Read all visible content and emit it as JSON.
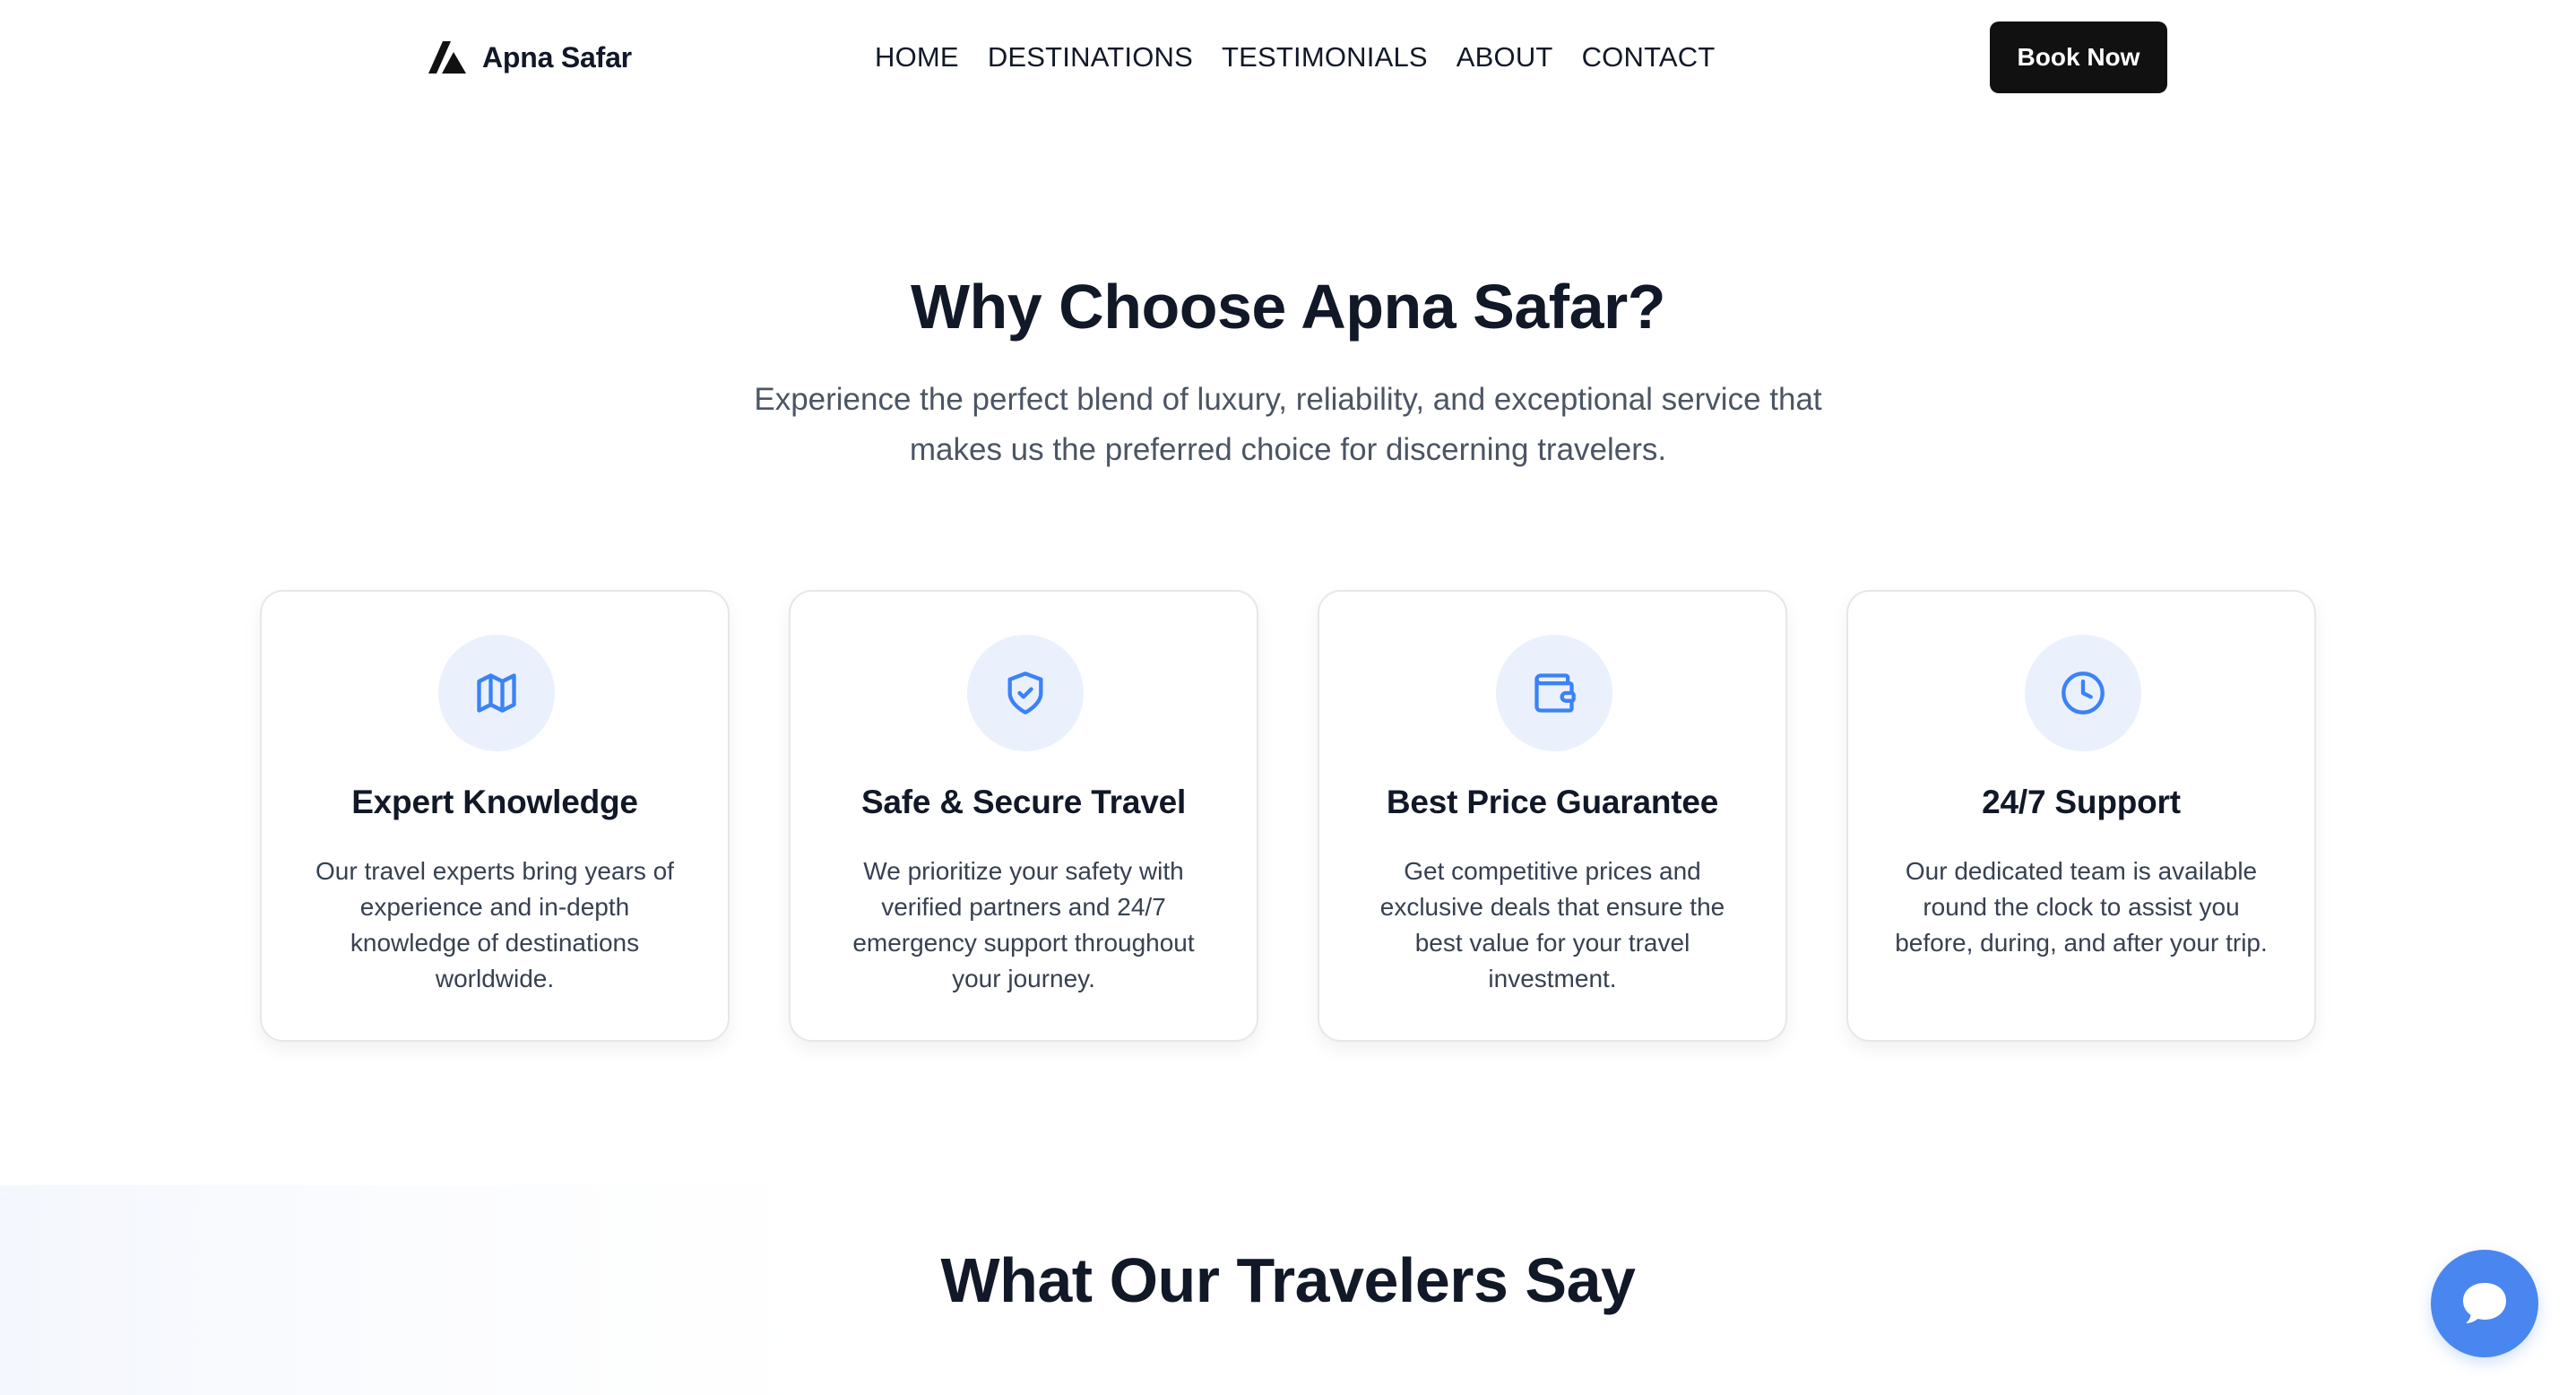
{
  "header": {
    "brand_name": "Apna Safar",
    "logo_icon": "mountain-logo-icon",
    "nav": [
      {
        "label": "HOME"
      },
      {
        "label": "DESTINATIONS"
      },
      {
        "label": "TESTIMONIALS"
      },
      {
        "label": "ABOUT"
      },
      {
        "label": "CONTACT"
      }
    ],
    "cta_label": "Book Now"
  },
  "why": {
    "title": "Why Choose Apna Safar?",
    "subtitle": "Experience the perfect blend of luxury, reliability, and exceptional service that makes us the preferred choice for discerning travelers.",
    "features": [
      {
        "icon": "map-icon",
        "title": "Expert Knowledge",
        "description": "Our travel experts bring years of experience and in-depth knowledge of destinations worldwide."
      },
      {
        "icon": "shield-check-icon",
        "title": "Safe & Secure Travel",
        "description": "We prioritize your safety with verified partners and 24/7 emergency support throughout your journey."
      },
      {
        "icon": "wallet-icon",
        "title": "Best Price Guarantee",
        "description": "Get competitive prices and exclusive deals that ensure the best value for your travel investment."
      },
      {
        "icon": "clock-icon",
        "title": "24/7 Support",
        "description": "Our dedicated team is available round the clock to assist you before, during, and after your trip."
      }
    ]
  },
  "testimonials": {
    "title": "What Our Travelers Say"
  },
  "chat": {
    "icon": "chat-bubble-icon"
  },
  "colors": {
    "accent": "#3b82f6",
    "icon_bg": "#eaf1fd",
    "cta_bg": "#111111",
    "chat_bg": "#4a86f0",
    "text_primary": "#111827",
    "text_muted": "#4b5563"
  }
}
